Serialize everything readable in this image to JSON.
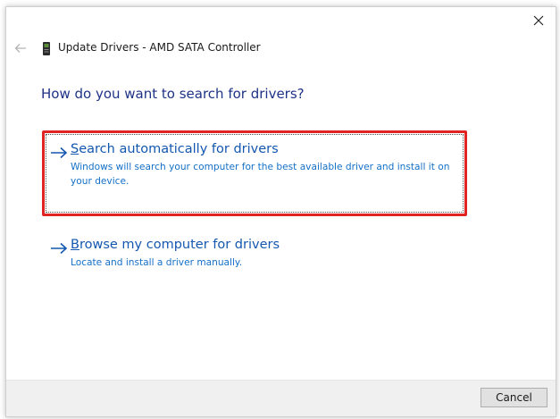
{
  "window": {
    "title": "Update Drivers - AMD SATA Controller"
  },
  "heading": "How do you want to search for drivers?",
  "options": [
    {
      "title_first": "S",
      "title_rest": "earch automatically for drivers",
      "description": "Windows will search your computer for the best available driver and install it on your device.",
      "icon": "arrow-right-icon",
      "highlighted": true
    },
    {
      "title_first": "B",
      "title_rest": "rowse my computer for drivers",
      "description": "Locate and install a driver manually.",
      "icon": "arrow-right-icon",
      "highlighted": false
    }
  ],
  "footer": {
    "cancel_label": "Cancel"
  },
  "colors": {
    "heading": "#1e3287",
    "option_title": "#1457b0",
    "option_desc": "#1470c8",
    "highlight_border": "#e02424"
  },
  "icons": {
    "close": "close-icon",
    "back": "back-arrow-icon",
    "device": "device-icon"
  }
}
